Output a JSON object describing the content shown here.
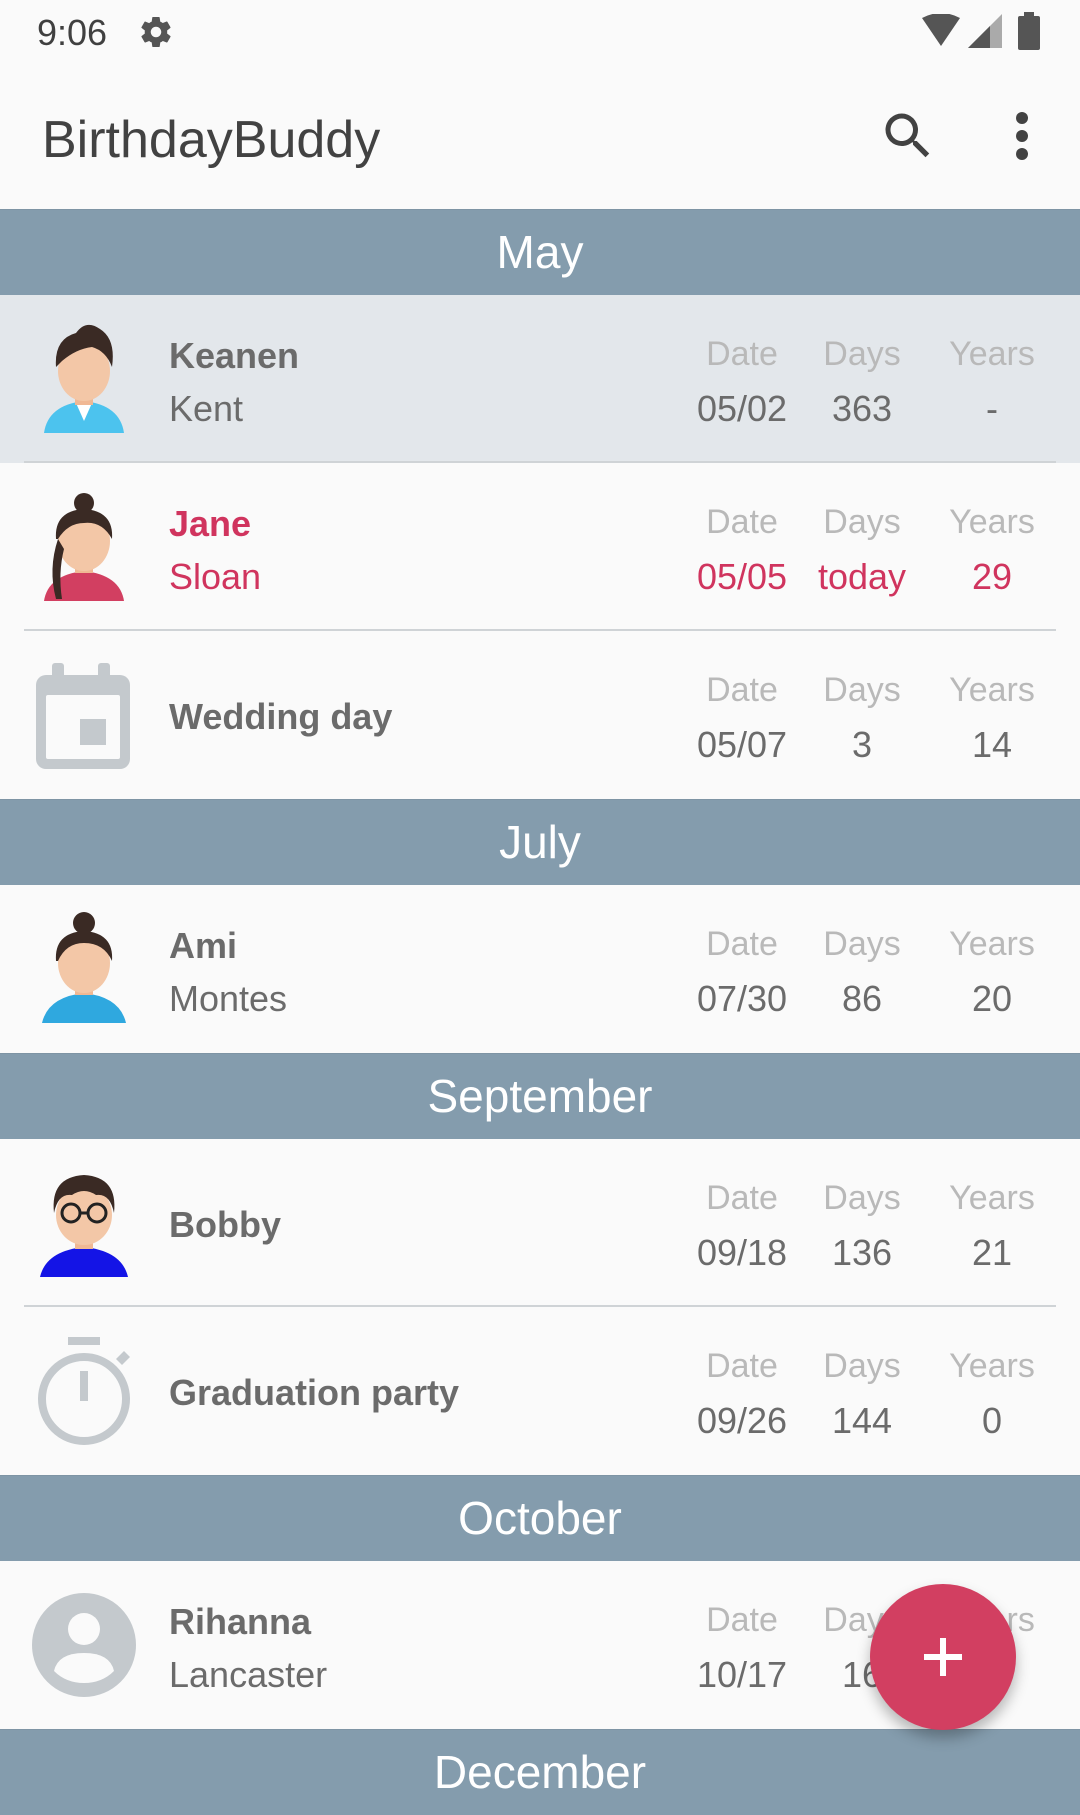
{
  "status_bar": {
    "time": "9:06"
  },
  "app_bar": {
    "title": "BirthdayBuddy",
    "search_icon": "search-icon",
    "more_icon": "more-vert-icon"
  },
  "columns": {
    "date": "Date",
    "days": "Days",
    "years": "Years"
  },
  "colors": {
    "header": "#849cad",
    "accent": "#d0345e",
    "fab": "#d23f61",
    "selected_row": "#e3e7eb"
  },
  "months": [
    {
      "label": "May",
      "entries": [
        {
          "first": "Keanen",
          "last": "Kent",
          "date": "05/02",
          "days": "363",
          "years": "-",
          "icon": "male-avatar-icon",
          "selected": true
        },
        {
          "first": "Jane",
          "last": "Sloan",
          "date": "05/05",
          "days": "today",
          "years": "29",
          "icon": "female-avatar-icon",
          "today": true
        },
        {
          "title": "Wedding day",
          "date": "05/07",
          "days": "3",
          "years": "14",
          "icon": "calendar-icon"
        }
      ]
    },
    {
      "label": "July",
      "entries": [
        {
          "first": "Ami",
          "last": "Montes",
          "date": "07/30",
          "days": "86",
          "years": "20",
          "icon": "female-bun-avatar-icon"
        }
      ]
    },
    {
      "label": "September",
      "entries": [
        {
          "title": "Bobby",
          "date": "09/18",
          "days": "136",
          "years": "21",
          "icon": "glasses-avatar-icon"
        },
        {
          "title": "Graduation party",
          "date": "09/26",
          "days": "144",
          "years": "0",
          "icon": "stopwatch-icon"
        }
      ]
    },
    {
      "label": "October",
      "entries": [
        {
          "first": "Rihanna",
          "last": "Lancaster",
          "date": "10/17",
          "days": "16",
          "years": "",
          "icon": "default-person-icon"
        }
      ]
    },
    {
      "label": "December",
      "entries": []
    }
  ],
  "fab": {
    "icon": "add-icon"
  }
}
